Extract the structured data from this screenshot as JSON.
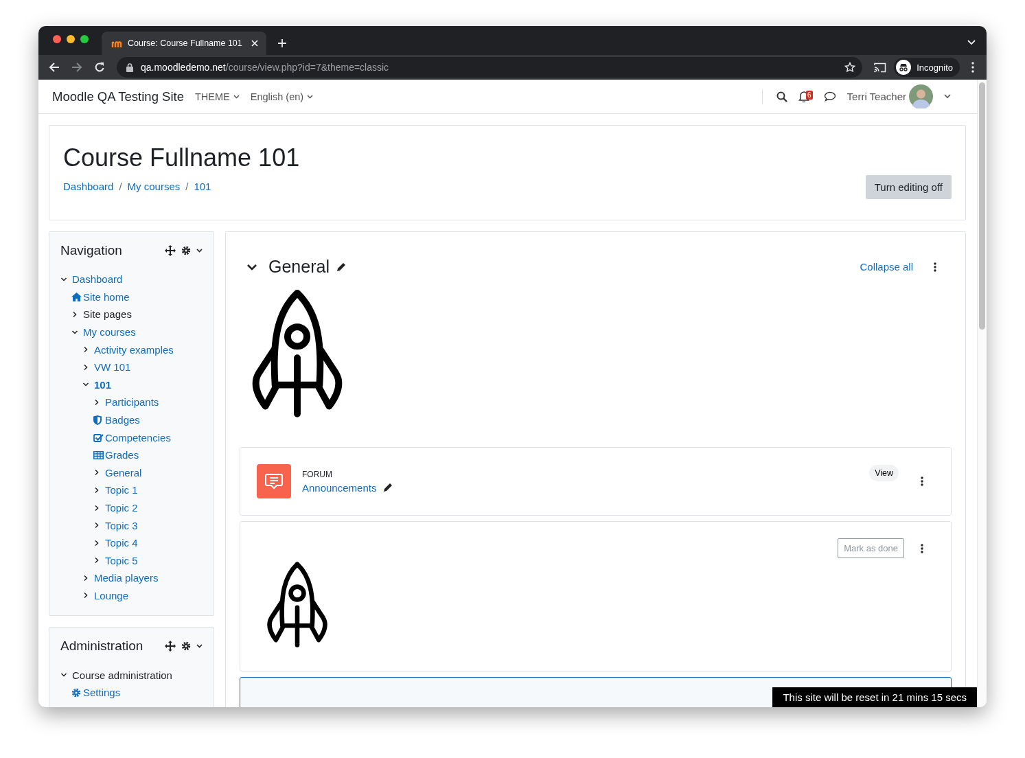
{
  "browser": {
    "tab_title": "Course: Course Fullname 101",
    "url_host": "qa.moodledemo.net",
    "url_path": "/course/view.php?id=7&theme=classic",
    "profile": "Incognito"
  },
  "navbar": {
    "site_name": "Moodle QA Testing Site",
    "menus": [
      "THEME",
      "English (en)"
    ],
    "notification_count": "6",
    "user_name": "Terri Teacher"
  },
  "header": {
    "title": "Course Fullname 101",
    "breadcrumb": [
      {
        "label": "Dashboard"
      },
      {
        "separator": "/",
        "label": "My courses"
      },
      {
        "separator": "/",
        "label": "101"
      }
    ],
    "edit_button": "Turn editing off"
  },
  "blocks": [
    {
      "title": "Navigation",
      "items": [
        {
          "label": "Dashboard",
          "kind": "branch",
          "link": true,
          "expanded": true,
          "current": false,
          "children": [
            {
              "label": "Site home",
              "kind": "home",
              "link": true,
              "current": false
            },
            {
              "label": "Site pages",
              "kind": "branch",
              "link": false,
              "expanded": false,
              "current": false
            },
            {
              "label": "My courses",
              "kind": "branch",
              "link": true,
              "expanded": true,
              "current": false,
              "children": [
                {
                  "label": "Activity examples",
                  "kind": "branch",
                  "link": true,
                  "expanded": false,
                  "current": false
                },
                {
                  "label": "VW 101",
                  "kind": "branch",
                  "link": true,
                  "expanded": false,
                  "current": false
                },
                {
                  "label": "101",
                  "kind": "branch",
                  "link": true,
                  "expanded": true,
                  "current": true,
                  "children": [
                    {
                      "label": "Participants",
                      "kind": "branch",
                      "link": true,
                      "expanded": false,
                      "current": false
                    },
                    {
                      "label": "Badges",
                      "kind": "shield",
                      "link": true,
                      "current": false
                    },
                    {
                      "label": "Competencies",
                      "kind": "check",
                      "link": true,
                      "current": false
                    },
                    {
                      "label": "Grades",
                      "kind": "table",
                      "link": true,
                      "current": false
                    },
                    {
                      "label": "General",
                      "kind": "branch",
                      "link": true,
                      "expanded": false,
                      "current": false
                    },
                    {
                      "label": "Topic 1",
                      "kind": "branch",
                      "link": true,
                      "expanded": false,
                      "current": false
                    },
                    {
                      "label": "Topic 2",
                      "kind": "branch",
                      "link": true,
                      "expanded": false,
                      "current": false
                    },
                    {
                      "label": "Topic 3",
                      "kind": "branch",
                      "link": true,
                      "expanded": false,
                      "current": false
                    },
                    {
                      "label": "Topic 4",
                      "kind": "branch",
                      "link": true,
                      "expanded": false,
                      "current": false
                    },
                    {
                      "label": "Topic 5",
                      "kind": "branch",
                      "link": true,
                      "expanded": false,
                      "current": false
                    }
                  ]
                },
                {
                  "label": "Media players",
                  "kind": "branch",
                  "link": true,
                  "expanded": false,
                  "current": false
                },
                {
                  "label": "Lounge",
                  "kind": "branch",
                  "link": true,
                  "expanded": false,
                  "current": false
                }
              ]
            }
          ]
        }
      ]
    },
    {
      "title": "Administration",
      "items": [
        {
          "label": "Course administration",
          "kind": "branch",
          "link": false,
          "expanded": true,
          "current": false,
          "children": [
            {
              "label": "Settings",
              "kind": "gear",
              "link": true,
              "current": false
            }
          ]
        }
      ]
    }
  ],
  "section": {
    "title": "General",
    "expanded": true,
    "collapse_link": "Collapse all"
  },
  "activities": [
    {
      "kind": "forum",
      "type_label": "FORUM",
      "name": "Announcements",
      "action": "View"
    },
    {
      "kind": "image",
      "action": "Mark as done"
    }
  ],
  "toast": "This site will be reset in 21 mins 15 secs"
}
